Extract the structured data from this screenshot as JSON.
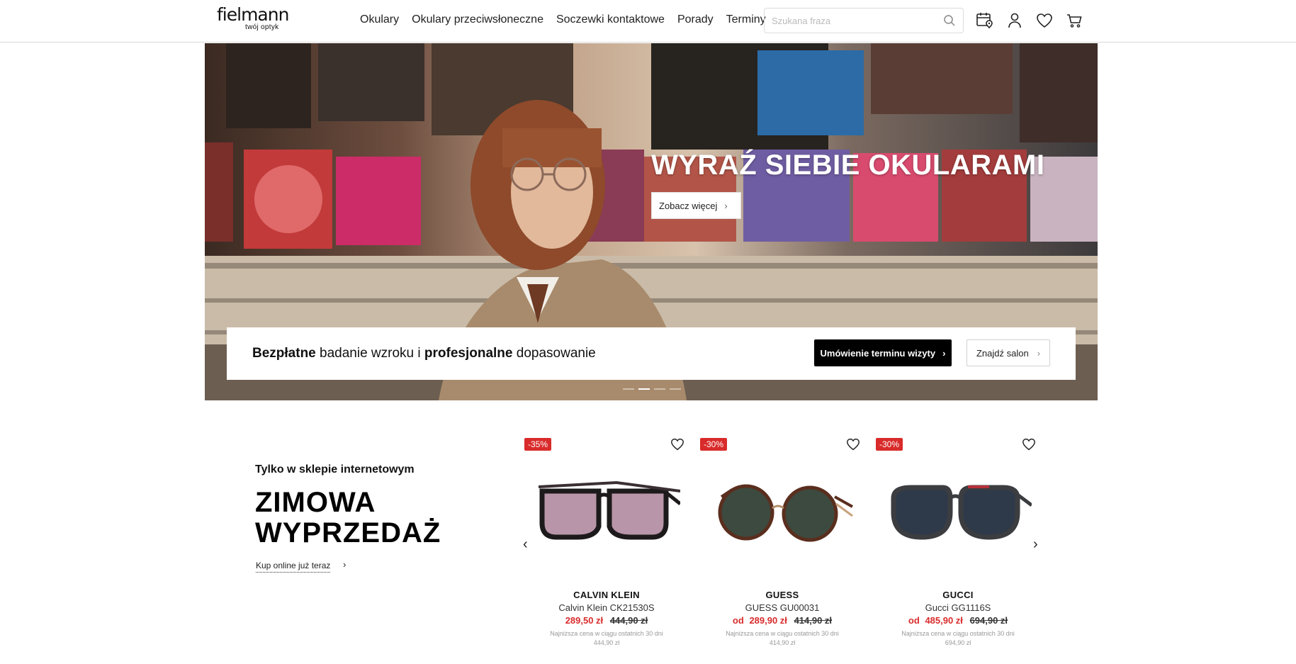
{
  "header": {
    "logo_main": "fielmann",
    "logo_sub": "twój optyk",
    "nav": [
      "Okulary",
      "Okulary przeciwsłoneczne",
      "Soczewki kontaktowe",
      "Porady",
      "Terminy"
    ],
    "search_placeholder": "Szukana fraza",
    "icons": [
      "appointment-icon",
      "account-icon",
      "heart-icon",
      "cart-icon"
    ]
  },
  "hero": {
    "title": "WYRAŹ SIEBIE OKULARAMI",
    "button": "Zobacz więcej",
    "slides_count": 4,
    "active_slide": 1
  },
  "strip": {
    "t1": "Bezpłatne",
    "t2": " badanie wzroku i ",
    "t3": "profesjonalne",
    "t4": " dopasowanie",
    "primary_button": "Umówienie terminu wizyty",
    "secondary_button": "Znajdź salon"
  },
  "sale": {
    "subtitle": "Tylko w sklepie internetowym",
    "title_line1": "ZIMOWA",
    "title_line2": "WYPRZEDAŻ",
    "link": "Kup online już teraz"
  },
  "products": [
    {
      "badge": "-35%",
      "brand": "CALVIN KLEIN",
      "model": "Calvin Klein CK21530S",
      "from": "",
      "price": "289,50 zł",
      "old_price": "444,90 zł",
      "lowest_label": "Najniższa cena w ciągu ostatnich 30 dni",
      "lowest_value": "444,90 zł",
      "lens_color": "#b895a9",
      "frame_color": "#1d1a1c"
    },
    {
      "badge": "-30%",
      "brand": "GUESS",
      "model": "GUESS GU00031",
      "from": "od",
      "price": "289,90 zł",
      "old_price": "414,90 zł",
      "lowest_label": "Najniższa cena w ciągu ostatnich 30 dni",
      "lowest_value": "414,90 zł",
      "lens_color": "#3c4a3f",
      "frame_color": "#5a2e1e"
    },
    {
      "badge": "-30%",
      "brand": "GUCCI",
      "model": "Gucci GG1116S",
      "from": "od",
      "price": "485,90 zł",
      "old_price": "694,90 zł",
      "lowest_label": "Najniższa cena w ciągu ostatnich 30 dni",
      "lowest_value": "694,90 zł",
      "lens_color": "#2e3a4a",
      "frame_color": "#3b3d40"
    }
  ]
}
